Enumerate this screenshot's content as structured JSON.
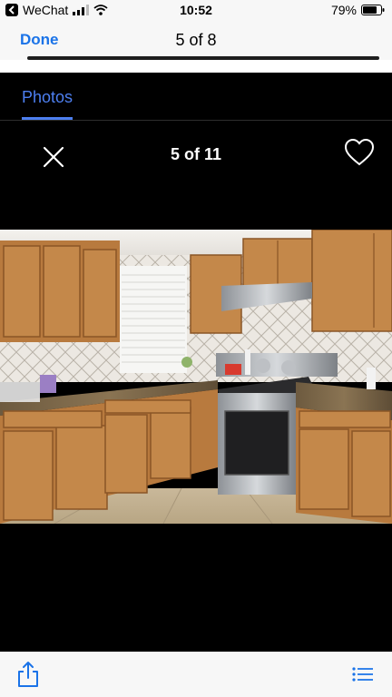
{
  "status_bar": {
    "carrier": "WeChat",
    "time": "10:52",
    "battery": "79%",
    "battery_level": 0.79
  },
  "navbar": {
    "done_label": "Done",
    "title": "5 of 8"
  },
  "viewer": {
    "tab_label": "Photos",
    "counter": "5 of 11"
  },
  "icons": {
    "back": "back-arrow-icon",
    "signal": "signal-bars-icon",
    "wifi": "wifi-icon",
    "battery": "battery-icon",
    "close": "close-icon",
    "heart": "heart-icon",
    "share": "share-icon",
    "list": "list-icon"
  },
  "colors": {
    "accent": "#1a73e8",
    "tab_accent": "#4d7ff0",
    "viewer_bg": "#000000",
    "chrome_bg": "#f7f7f7"
  }
}
